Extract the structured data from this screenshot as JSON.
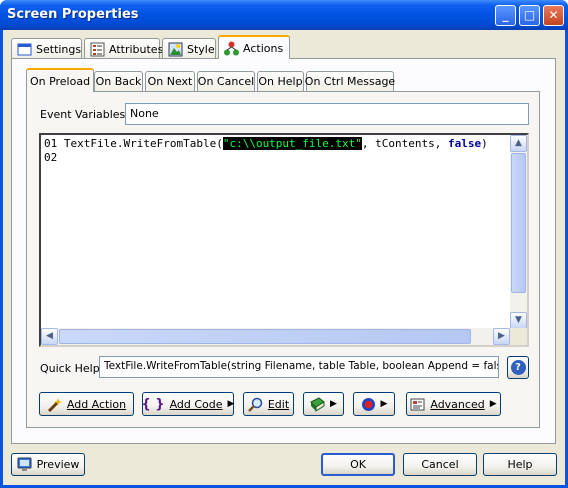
{
  "window": {
    "title": "Screen Properties",
    "controls": [
      "_",
      "□",
      "✕"
    ]
  },
  "main_tabs": [
    {
      "label": "Settings",
      "icon": "settings-window-icon"
    },
    {
      "label": "Attributes",
      "icon": "attributes-list-icon"
    },
    {
      "label": "Style",
      "icon": "style-image-icon"
    },
    {
      "label": "Actions",
      "icon": "actions-tree-icon",
      "selected": true
    }
  ],
  "event_tabs": [
    "On Preload",
    "On Back",
    "On Next",
    "On Cancel",
    "On Help",
    "On Ctrl Message"
  ],
  "selected_event_tab": "On Preload",
  "event_variables": {
    "label": "Event Variables:",
    "value": "None"
  },
  "code": {
    "line1_no": "01",
    "line1_func": "TextFile.WriteFromTable(",
    "line1_arg1": "\"c:\\\\output_file.txt\"",
    "line1_sep1": ", tContents, ",
    "line1_arg3": "false",
    "line1_end": ")",
    "line2_no": "02"
  },
  "quick_help": {
    "label": "Quick Help:",
    "value": "TextFile.WriteFromTable(string Filename, table Table, boolean Append = false)",
    "help_icon": "?"
  },
  "action_buttons": [
    {
      "label": "Add Action",
      "icon": "wand-icon"
    },
    {
      "label": "Add Code",
      "icon": "braces-icon"
    },
    {
      "label": "Edit",
      "icon": "magnifier-icon"
    },
    {
      "label": "",
      "icon": "book-icon"
    },
    {
      "label": "",
      "icon": "record-icon"
    },
    {
      "label": "Advanced",
      "icon": "advanced-icon"
    }
  ],
  "footer": {
    "preview": "Preview",
    "ok": "OK",
    "cancel": "Cancel",
    "help": "Help"
  },
  "colors": {
    "titlebar": "#0054e3",
    "client": "#ece9d8",
    "highlight_bg": "#000000",
    "highlight_fg": "#00ff40",
    "keyword": "#00009e",
    "tab_accent": "#f8a900"
  }
}
